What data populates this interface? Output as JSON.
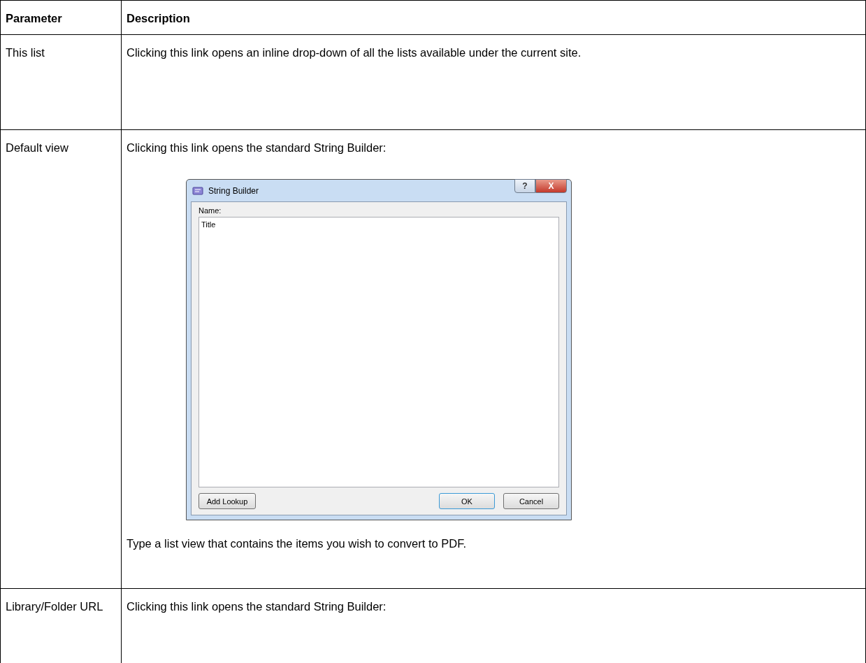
{
  "table": {
    "columns": [
      "Parameter",
      "Description"
    ],
    "rows": [
      {
        "parameter": "This list",
        "blocks": [
          {
            "kind": "text",
            "text": "Clicking this link opens an inline drop-down of all the lists available under the current site."
          }
        ]
      },
      {
        "parameter": "Default view",
        "blocks": [
          {
            "kind": "text",
            "text": "Clicking this link opens the standard String Builder:"
          },
          {
            "kind": "dialog",
            "title": "String Builder",
            "help_button": "?",
            "close_button": "X",
            "field_label": "Name:",
            "field_value": "Title",
            "buttons": [
              {
                "label": "Add Lookup",
                "default": false
              },
              {
                "label": "OK",
                "default": true
              },
              {
                "label": "Cancel",
                "default": false
              }
            ]
          },
          {
            "kind": "text",
            "text": "Type a list view that contains the items you wish to convert to PDF."
          }
        ]
      },
      {
        "parameter": "Library/Folder URL",
        "blocks": [
          {
            "kind": "text",
            "text": "Clicking this link opens the standard String Builder:"
          }
        ]
      }
    ]
  }
}
